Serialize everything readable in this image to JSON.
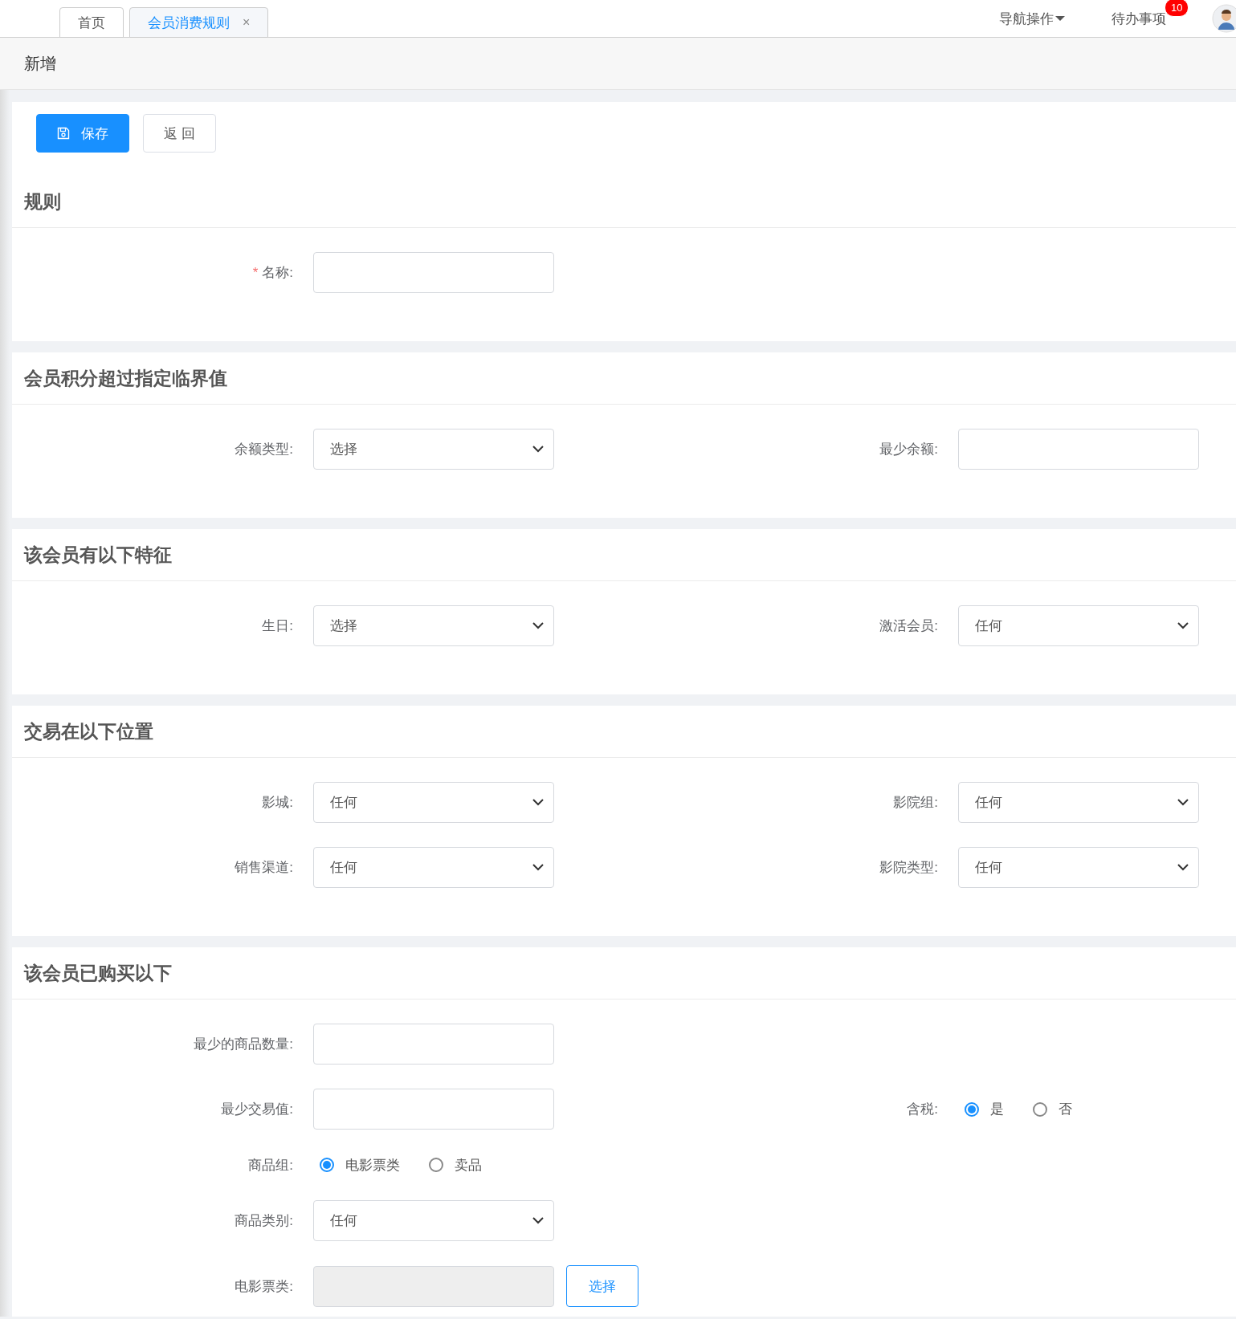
{
  "tabs": [
    {
      "label": "首页",
      "selected": false
    },
    {
      "label": "会员消费规则",
      "selected": true,
      "close": "×"
    }
  ],
  "top_nav": {
    "menu": "导航操作",
    "todo": "待办事项",
    "todo_badge": "10"
  },
  "page_title": "新增",
  "toolbar": [
    {
      "label": "保存",
      "kind": "primary"
    },
    {
      "label": "返 回",
      "kind": "default"
    }
  ],
  "sections": [
    {
      "title": "规则",
      "rows": [
        {
          "fields": [
            {
              "label": "名称:",
              "required_mark": "*",
              "kind": "input"
            }
          ]
        }
      ]
    },
    {
      "title": "会员积分超过指定临界值",
      "rows": [
        {
          "fields": [
            {
              "label": "余额类型:",
              "kind": "select",
              "value": "选择"
            },
            {
              "label": "最少余额:",
              "kind": "input"
            }
          ]
        }
      ]
    },
    {
      "title": "该会员有以下特征",
      "rows": [
        {
          "fields": [
            {
              "label": "生日:",
              "kind": "select",
              "value": "选择"
            },
            {
              "label": "激活会员:",
              "kind": "select",
              "value": "任何"
            }
          ]
        }
      ]
    },
    {
      "title": "交易在以下位置",
      "rows": [
        {
          "fields": [
            {
              "label": "影城:",
              "kind": "select",
              "value": "任何"
            },
            {
              "label": "影院组:",
              "kind": "select",
              "value": "任何"
            }
          ]
        },
        {
          "fields": [
            {
              "label": "销售渠道:",
              "kind": "select",
              "value": "任何"
            },
            {
              "label": "影院类型:",
              "kind": "select",
              "value": "任何"
            }
          ]
        }
      ]
    },
    {
      "title": "该会员已购买以下",
      "rows": [
        {
          "fields": [
            {
              "label": "最少的商品数量:",
              "kind": "input"
            }
          ]
        },
        {
          "fields": [
            {
              "label": "最少交易值:",
              "kind": "input"
            },
            {
              "label": "含税:",
              "kind": "radio",
              "options": [
                {
                  "label": "是",
                  "selected": true
                },
                {
                  "label": "否",
                  "selected": false
                }
              ]
            }
          ]
        },
        {
          "fields": [
            {
              "label": "商品组:",
              "kind": "radio",
              "options": [
                {
                  "label": "电影票类",
                  "selected": true
                },
                {
                  "label": "卖品",
                  "selected": false
                }
              ]
            }
          ]
        },
        {
          "fields": [
            {
              "label": "商品类别:",
              "kind": "select",
              "value": "任何"
            }
          ]
        },
        {
          "fields": [
            {
              "label": "电影票类:",
              "kind": "picker",
              "disabled": true,
              "button": "选择"
            }
          ]
        }
      ]
    }
  ]
}
